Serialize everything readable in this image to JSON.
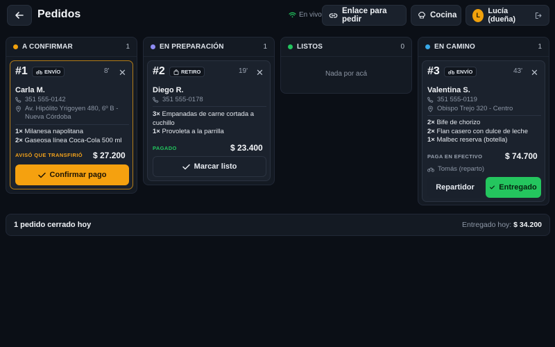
{
  "header": {
    "title": "Pedidos",
    "live_status": "En vivo",
    "order_link_label": "Enlace para pedir",
    "kitchen_label": "Cocina",
    "user_initial": "L",
    "user_name": "Lucía (dueña)"
  },
  "columns": {
    "to_confirm": {
      "title": "A CONFIRMAR",
      "count": "1",
      "dot_color": "#f0a00c"
    },
    "in_prep": {
      "title": "EN PREPARACIÓN",
      "count": "1",
      "dot_color": "#8e8cf2"
    },
    "ready": {
      "title": "LISTOS",
      "count": "0",
      "dot_color": "#22c55e",
      "empty_text": "Nada por acá"
    },
    "on_the_way": {
      "title": "EN CAMINO",
      "count": "1",
      "dot_color": "#38a9e8"
    }
  },
  "orders": {
    "o1": {
      "number": "#1",
      "type": "ENVÍO",
      "minutes": "8'",
      "customer": "Carla M.",
      "phone": "351 555-0142",
      "address": [
        "Av. Hipólito Yrigoyen 480, 6º B -",
        "Nueva Córdoba"
      ],
      "items": [
        {
          "qty": "1×",
          "name": "Milanesa napolitana"
        },
        {
          "qty": "2×",
          "name": "Gaseosa línea Coca-Cola 500 ml"
        }
      ],
      "payment_status": "AVISÓ QUE TRANSFIRIÓ",
      "payment_color": "#f2a11a",
      "total": "$ 27.200",
      "action": "Confirmar pago"
    },
    "o2": {
      "number": "#2",
      "type": "RETIRO",
      "minutes": "19'",
      "customer": "Diego R.",
      "phone": "351 555-0178",
      "items": [
        {
          "qty": "3×",
          "name": "Empanadas de carne cortada a",
          "cont": "cuchillo"
        },
        {
          "qty": "1×",
          "name": "Provoleta a la parrilla"
        }
      ],
      "payment_status": "PAGADO",
      "payment_color": "#22c55e",
      "total": "$ 23.400",
      "action": "Marcar listo"
    },
    "o3": {
      "number": "#3",
      "type": "ENVÍO",
      "minutes": "43'",
      "customer": "Valentina S.",
      "phone": "351 555-0119",
      "address": [
        "Obispo Trejo 320 - Centro"
      ],
      "items": [
        {
          "qty": "2×",
          "name": "Bife de chorizo"
        },
        {
          "qty": "2×",
          "name": "Flan casero con dulce de leche"
        },
        {
          "qty": "1×",
          "name": "Malbec reserva (botella)"
        }
      ],
      "payment_status": "PAGA EN EFECTIVO",
      "payment_color": "#9aa3b1",
      "total": "$ 74.700",
      "delivery_person": "Tomás (reparto)",
      "secondary_action": "Repartidor",
      "action": "Entregado"
    }
  },
  "closed": {
    "summary": "1 pedido cerrado hoy",
    "delivered_label": "Entregado hoy:",
    "delivered_total": "$ 34.200"
  }
}
